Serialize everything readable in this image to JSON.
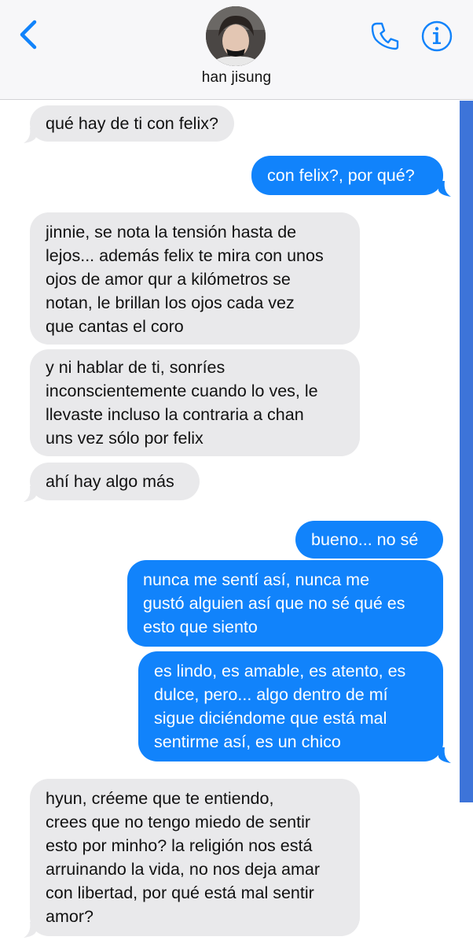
{
  "contact": {
    "name": "han jisung",
    "avatar_icon": "person-avatar"
  },
  "header": {
    "back_icon": "chevron-left-icon",
    "call_icon": "phone-icon",
    "info_icon": "info-icon",
    "accent_color": "#1183fb"
  },
  "messages": [
    {
      "from": "them",
      "lines": [
        "qué hay de ti con felix?"
      ]
    },
    {
      "from": "me",
      "lines": [
        "con felix?, por qué?"
      ]
    },
    {
      "from": "them",
      "lines": [
        "jinnie, se nota la tensión hasta de",
        "lejos... además felix te mira con unos",
        "ojos de amor qur a kilómetros se",
        "notan, le brillan los ojos cada vez",
        "que cantas el coro"
      ]
    },
    {
      "from": "them",
      "lines": [
        "y ni hablar de ti, sonríes",
        "inconscientemente cuando lo ves, le",
        "llevaste incluso la contraria a chan",
        "uns vez sólo por felix"
      ]
    },
    {
      "from": "them",
      "lines": [
        "ahí hay algo más"
      ]
    },
    {
      "from": "me",
      "lines": [
        "bueno... no sé"
      ]
    },
    {
      "from": "me",
      "lines": [
        "nunca me sentí así, nunca me",
        "gustó alguien así que no sé qué es",
        "esto que siento"
      ]
    },
    {
      "from": "me",
      "lines": [
        "es lindo, es amable, es atento, es",
        "dulce, pero... algo dentro de mí",
        "sigue diciéndome que está mal",
        "sentirme así, es un chico"
      ]
    },
    {
      "from": "them",
      "lines": [
        "hyun, créeme que te entiendo,",
        "crees que no tengo miedo de sentir",
        "esto por minho? la religión nos está",
        "arruinando la vida, no nos deja amar",
        "con libertad, por qué está mal sentir",
        "amor?"
      ]
    }
  ]
}
